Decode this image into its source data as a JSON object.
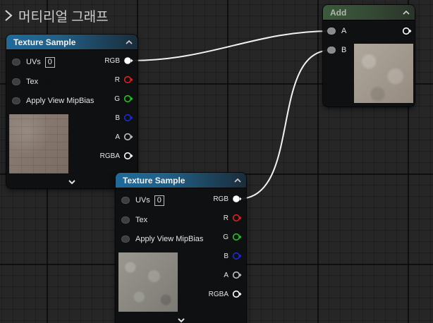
{
  "graph": {
    "title": "머티리얼 그래프"
  },
  "colors": {
    "wire": "#f2f2f2",
    "pin_rgb": "#ffffff",
    "pin_r": "#e02020",
    "pin_g": "#22c622",
    "pin_b": "#1e2ad6",
    "pin_a": "#bfbfbf",
    "pin_rgba": "#ffffff"
  },
  "node_add": {
    "title": "Add",
    "inputs": [
      {
        "label": "A"
      },
      {
        "label": "B"
      }
    ],
    "icons": [
      "collapse-up-icon",
      "output-pin-icon"
    ]
  },
  "node_tex1": {
    "title": "Texture Sample",
    "inputs": [
      {
        "label": "UVs",
        "value": "0"
      },
      {
        "label": "Tex"
      },
      {
        "label": "Apply View MipBias"
      }
    ],
    "outputs": [
      "RGB",
      "R",
      "G",
      "B",
      "A",
      "RGBA"
    ]
  },
  "node_tex2": {
    "title": "Texture Sample",
    "inputs": [
      {
        "label": "UVs",
        "value": "0"
      },
      {
        "label": "Tex"
      },
      {
        "label": "Apply View MipBias"
      }
    ],
    "outputs": [
      "RGB",
      "R",
      "G",
      "B",
      "A",
      "RGBA"
    ]
  }
}
